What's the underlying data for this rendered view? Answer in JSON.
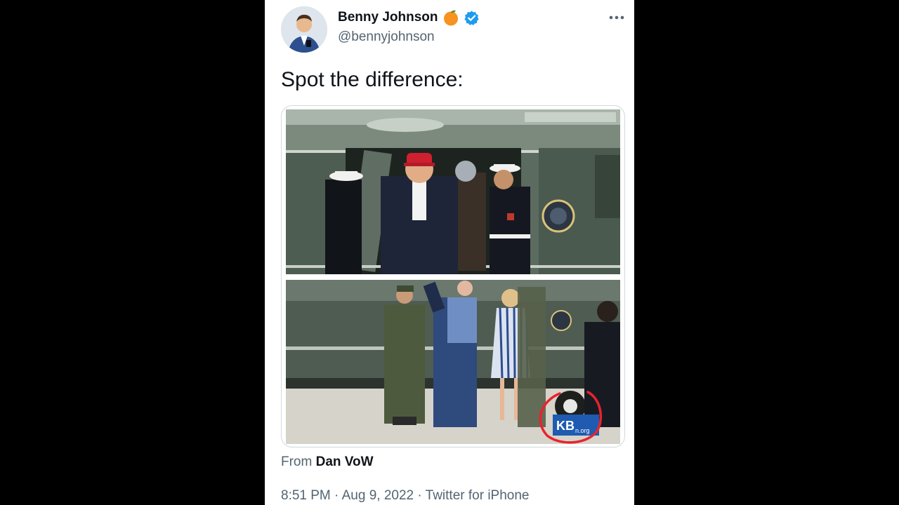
{
  "author": {
    "display_name": "Benny Johnson",
    "handle": "@bennyjohnson",
    "emoji_badge": "orange-emoji",
    "verified_icon": "verified-badge-icon",
    "verified_color": "#1d9bf0"
  },
  "tweet": {
    "text": "Spot the difference:"
  },
  "media": {
    "watermark_text": "KB",
    "watermark_sub": "n.org",
    "annotation_color": "#e8232e"
  },
  "attribution": {
    "prefix": "From",
    "source": "Dan VoW"
  },
  "footer": {
    "time": "8:51 PM",
    "sep1": "·",
    "date": "Aug 9, 2022",
    "sep2": "·",
    "client": "Twitter for iPhone"
  },
  "colors": {
    "background": "#000000",
    "card": "#ffffff",
    "text_primary": "#0f1419",
    "text_secondary": "#536471",
    "border": "#cfd9de"
  }
}
